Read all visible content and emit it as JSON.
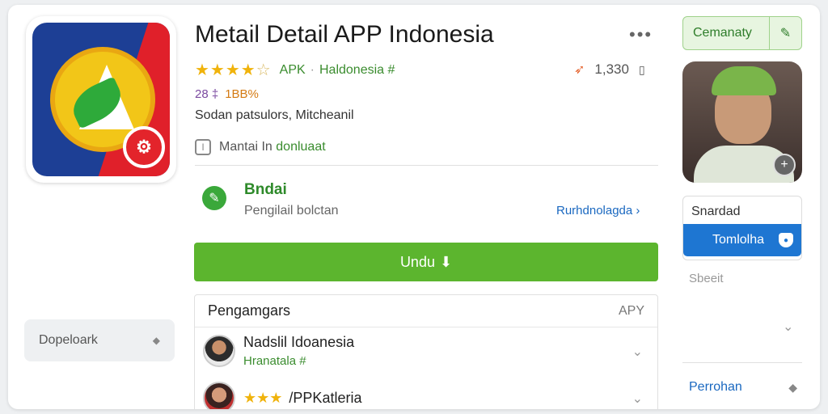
{
  "app": {
    "title": "Metail Detail APP Indonesia",
    "stars": "★★★★",
    "stars_empty": "☆",
    "type_label": "APK",
    "separator": "·",
    "country": "Haldonesia #",
    "downloads": "1,330",
    "meta_size": "28 ‡",
    "meta_rate": "1BB%",
    "developer_line": "Sodan patsulors, Mitcheanil",
    "install_text": "Mantai In ",
    "install_link": "donluaat",
    "more_icon": "•••"
  },
  "developer": {
    "name": "Bndai",
    "subtitle": "Pengilail bolctan",
    "link": "Rurhdnolagda ›"
  },
  "download_button": {
    "label": "Undu",
    "icon": "⬇"
  },
  "related": {
    "header": "Pengamgars",
    "type": "APY",
    "items": [
      {
        "title": "Nadslil Idoanesia",
        "subtitle": "Hranatala #"
      },
      {
        "stars": "★★★",
        "title": "/PPKatleria"
      }
    ]
  },
  "sidebar": {
    "button_label": "Dopeloark",
    "button_icon": "◆"
  },
  "right": {
    "top_button": "Cemanaty",
    "panel_title": "Snardad",
    "panel_button": "Tomlolha",
    "label": "Sbeeit",
    "bottom_link": "Perrohan"
  },
  "colors": {
    "accent_green": "#5cb52e",
    "link_blue": "#1a68c0",
    "star_yellow": "#f0b30c",
    "button_blue": "#1e76d2"
  },
  "icons": {
    "edit": "pencil-icon",
    "plus": "plus-icon",
    "shield": "shield-icon",
    "chevron": "chevron-down-icon"
  }
}
